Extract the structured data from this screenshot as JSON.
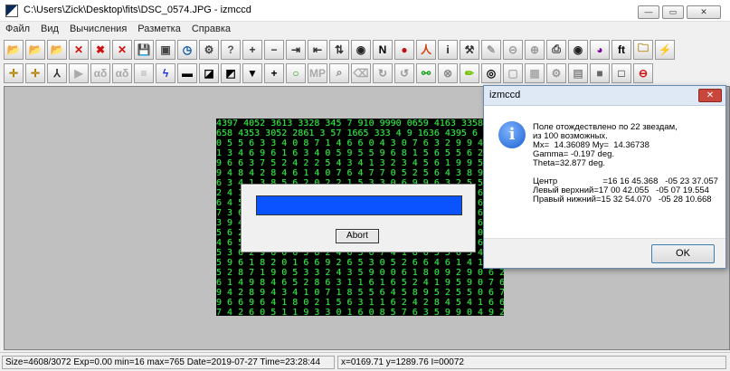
{
  "window": {
    "title": "C:\\Users\\Zick\\Desktop\\fits\\DSC_0574.JPG - izmccd",
    "minimize_glyph": "—",
    "maximize_glyph": "▭",
    "close_glyph": "✕"
  },
  "menu": [
    "Файл",
    "Вид",
    "Вычисления",
    "Разметка",
    "Справка"
  ],
  "toolbar1": [
    {
      "name": "open-folder-icon",
      "glyph": "📂"
    },
    {
      "name": "open-folder-2-icon",
      "glyph": "📂"
    },
    {
      "name": "open-folder-3-icon",
      "glyph": "📂"
    },
    {
      "name": "delete-icon",
      "glyph": "✕"
    },
    {
      "name": "delete-multiple-icon",
      "glyph": "✖"
    },
    {
      "name": "clear-icon",
      "glyph": "✕"
    },
    {
      "name": "save-icon",
      "glyph": "💾"
    },
    {
      "name": "stack-icon",
      "glyph": "▣"
    },
    {
      "name": "clock-icon",
      "glyph": "◷"
    },
    {
      "name": "settings-icon",
      "glyph": "⚙"
    },
    {
      "name": "help-icon",
      "glyph": "?"
    },
    {
      "name": "zoom-in-icon",
      "glyph": "+"
    },
    {
      "name": "zoom-out-icon",
      "glyph": "−"
    },
    {
      "name": "arrow-right-icon",
      "glyph": "⇥"
    },
    {
      "name": "arrow-left-icon",
      "glyph": "⇤"
    },
    {
      "name": "flip-vertical-icon",
      "glyph": "⇅"
    },
    {
      "name": "eye-icon",
      "glyph": "◉"
    },
    {
      "name": "north-icon",
      "glyph": "N"
    },
    {
      "name": "globe-icon",
      "glyph": "●"
    },
    {
      "name": "figure-icon",
      "glyph": "人"
    },
    {
      "name": "info-icon",
      "glyph": "i"
    },
    {
      "name": "hammer-icon",
      "glyph": "⚒"
    },
    {
      "name": "pen-icon",
      "glyph": "✎"
    },
    {
      "name": "link-icon",
      "glyph": "⊝"
    },
    {
      "name": "binoculars-icon",
      "glyph": "⊕"
    },
    {
      "name": "print-icon",
      "glyph": "⎙"
    },
    {
      "name": "palette-icon",
      "glyph": "◉"
    },
    {
      "name": "color-wheel-icon",
      "glyph": "◕"
    },
    {
      "name": "ft-icon",
      "glyph": "ft"
    },
    {
      "name": "folder-icon",
      "glyph": "🗀"
    },
    {
      "name": "zigzag-icon",
      "glyph": "⚡"
    }
  ],
  "toolbar2": [
    {
      "name": "crosshair-icon",
      "glyph": "✛"
    },
    {
      "name": "crosshair-2-icon",
      "glyph": "✛"
    },
    {
      "name": "angle-icon",
      "glyph": "⅄"
    },
    {
      "name": "play-icon",
      "glyph": "▶"
    },
    {
      "name": "alpha-delta-icon",
      "glyph": "αδ"
    },
    {
      "name": "alpha-delta-2-icon",
      "glyph": "αδ"
    },
    {
      "name": "list-icon",
      "glyph": "≡"
    },
    {
      "name": "bolt-icon",
      "glyph": "ϟ"
    },
    {
      "name": "minus-square-icon",
      "glyph": "▬"
    },
    {
      "name": "slash-square-icon",
      "glyph": "◪"
    },
    {
      "name": "corner-square-icon",
      "glyph": "◩"
    },
    {
      "name": "triangle-square-icon",
      "glyph": "▼"
    },
    {
      "name": "plus-square-icon",
      "glyph": "+"
    },
    {
      "name": "circle-icon",
      "glyph": "○"
    },
    {
      "name": "mp-icon",
      "glyph": "MP"
    },
    {
      "name": "search-icon",
      "glyph": "⌕"
    },
    {
      "name": "eraser-icon",
      "glyph": "⌫"
    },
    {
      "name": "rotate-icon",
      "glyph": "↻"
    },
    {
      "name": "rotate-2-icon",
      "glyph": "↺"
    },
    {
      "name": "link-2-icon",
      "glyph": "⚯"
    },
    {
      "name": "gauge-icon",
      "glyph": "⊗"
    },
    {
      "name": "pencil-icon",
      "glyph": "✏"
    },
    {
      "name": "target-icon",
      "glyph": "◎"
    },
    {
      "name": "film-icon",
      "glyph": "▢"
    },
    {
      "name": "image-icon",
      "glyph": "▦"
    },
    {
      "name": "gear-icon",
      "glyph": "⚙"
    },
    {
      "name": "layers-icon",
      "glyph": "▤"
    },
    {
      "name": "stop-icon",
      "glyph": "■"
    },
    {
      "name": "square-icon",
      "glyph": "□"
    },
    {
      "name": "no-entry-icon",
      "glyph": "⊖"
    }
  ],
  "starfield_text": "4397 4052 3613 3328 345 7 910 9990 0659 4163 3358 5456 0658 4353 3052 2861 3 57 1665 333 4 9 1636 4395 6 8 8 2 5 0 5 5 6 3 3 4 0 8 7 1 4 6 6 0 4 3 0 7 6 3 2 9 9 4 9 8 5 1 3 4 6 9 6 1 6 3 4 0 5 9 5 5 9 6 8 1 5 6 5 5 6 2 6 2 3 9 6 6 3 7 5 2 4 2 2 5 4 3 4 1 3 2 3 4 5 6 1 9 9 5 0 9 6 9 4 8 4 2 8 4 6 1 4 0 7 6 4 7 7 0 5 2 5 6 4 3 8 9 4 2 6 6 3 4 1 3 8 5 6 2 0 2 2 1 5 3 3 0 6 9 9 6 3 2 5 5 9 6 3 2 4 1 3 7 5 1 0 6 4 3 1 3 5 3 9 4 8 0 7 6 5 7 3 6 4 0 3 6 4 5 3 6 8 5 4 0 7 6 6 4 6 1 4 1 6 2 8 6 9 8 0 6 5 9 8 7 3 6 0 6 7 4 6 5 9 5 4 1 8 6 1 9 7 2 6 3 8 6 0 6 6 1 8 3 9 4 1 0 4 8 2 6 3 4 0 4 6 8 0 6 4 9 6 9 6 1 8 6 8 4 8 5 6 2 7 8 9 3 5 0 7 3 6 5 1 5 2 4 8 4 2 4 5 9 6 0 6 1 3 4 6 5 7 3 9 0 0 8 6 3 4 3 1 6 4 4 0 9 2 0 6 1 5 6 8 1 4 5 3 6 2 9 6 0 6 5 8 2 4 6 3 0 7 4 1 8 6 5 5 6 5 4 1 5 0 5 9 6 1 8 2 0 1 6 6 9 2 6 5 3 0 5 2 6 6 4 6 1 4 1 6 3 0 5 2 8 7 1 9 0 5 3 3 2 4 3 5 9 0 0 6 1 8 0 9 2 9 0 6 2 0 6 1 4 9 8 4 6 5 2 8 6 3 1 1 6 1 6 5 2 4 1 9 5 9 0 7 6 5 9 4 2 8 9 4 3 4 1 0 7 1 8 5 5 6 4 5 8 9 5 2 5 5 0 6 7 4 9 6 6 9 6 4 1 8 0 2 1 5 6 3 1 1 6 2 4 2 8 4 5 4 1 6 6 9 7 4 2 6 0 5 1 1 9 3 3 0 1 6 0 8 5 7 6 3 5 9 9 0 4 9 2 6 9 4 0 8 7 3 2 6 4 4 5 1 0 6 3 1 1 6 2 6 2 0 6 9 3 2 6 5 6 5 9 4 5 1 0 9 5 0 1 6 6 2 4 8 8 2 5 1 4 6 9 7 0 6 2 8 2 4 4 3 9 2 6 6 5 4 5 5 7 6 7 6",
  "progress_dialog": {
    "progress": 1.0,
    "abort_label": "Abort"
  },
  "message_box": {
    "title": "izmccd",
    "close_glyph": "✕",
    "icon_glyph": "i",
    "text": "Поле отождествлено по 22 звездам,\nиз 100 возможных.\nMx=  14.36089 My=  14.36738\nGamma= -0.197 deg.\nTheta=32.877 deg.\n\nЦентр                   =16 16 45.368   -05 23 37.057\nЛевый верхний=17 00 42.055   -05 07 19.554\nПравый нижний=15 32 54.070   -05 28 10.668",
    "ok_label": "OK"
  },
  "status": {
    "left": "Size=4608/3072 Exp=0.00 min=16 max=765 Date=2019-07-27 Time=23:28:44",
    "right": "x=0169.71 y=1289.76 I=00072"
  },
  "colors": {
    "progress_fill": "#0a53ff",
    "star_digits": "#35e04a",
    "workspace": "#c0c0c0"
  }
}
